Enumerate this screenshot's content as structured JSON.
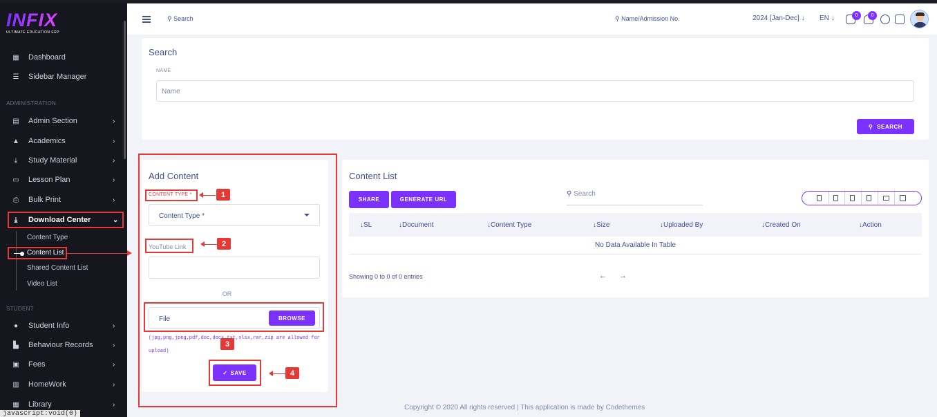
{
  "logo": {
    "name": "INFIX",
    "tagline": "ULTIMATE EDUCATION ERP"
  },
  "sidebar": {
    "top_items": [
      {
        "label": "Dashboard",
        "icon": "grid-icon"
      },
      {
        "label": "Sidebar Manager",
        "icon": "list-icon"
      }
    ],
    "sections": [
      {
        "title": "ADMINISTRATION"
      },
      {
        "title": "STUDENT"
      }
    ],
    "admin_items": [
      {
        "label": "Admin Section",
        "icon": "admin-icon"
      },
      {
        "label": "Academics",
        "icon": "graduation-cap-icon"
      },
      {
        "label": "Study Material",
        "icon": "download-icon"
      },
      {
        "label": "Lesson Plan",
        "icon": "lesson-icon"
      },
      {
        "label": "Bulk Print",
        "icon": "print-icon"
      },
      {
        "label": "Download Center",
        "icon": "download-icon"
      }
    ],
    "download_sub": [
      "Content Type",
      "Content List",
      "Shared Content List",
      "Video List"
    ],
    "student_items": [
      {
        "label": "Student Info",
        "icon": "user-icon"
      },
      {
        "label": "Behaviour Records",
        "icon": "records-icon"
      },
      {
        "label": "Fees",
        "icon": "fees-icon"
      },
      {
        "label": "HomeWork",
        "icon": "book-icon"
      },
      {
        "label": "Library",
        "icon": "library-icon"
      }
    ],
    "status_text": "javascript:void(0)"
  },
  "topbar": {
    "search": "Search",
    "name_search": "Name/Admission No.",
    "year": "2024 [Jan-Dec]",
    "lang": "EN",
    "chat_badge": "0",
    "notif_badge": "0"
  },
  "search_panel": {
    "title": "Search",
    "name_label": "NAME",
    "name_placeholder": "Name",
    "button": "SEARCH"
  },
  "add_content": {
    "title": "Add Content",
    "content_type_label": "CONTENT TYPE *",
    "content_type_value": "Content Type *",
    "youtube_label": "YouTube Link",
    "or": "OR",
    "file_placeholder": "File",
    "browse": "BROWSE",
    "hint": "(jpg,png,jpeg,pdf,doc,docx,txt,xlsx,rar,zip are allowed for upload)",
    "save": "SAVE",
    "step_numbers": [
      "1",
      "2",
      "3",
      "4"
    ]
  },
  "content_list": {
    "title": "Content List",
    "share": "SHARE",
    "generate_url": "GENERATE URL",
    "search_placeholder": "Search",
    "columns": [
      "SL",
      "Document",
      "Content Type",
      "Size",
      "Uploaded By",
      "Created On",
      "Action"
    ],
    "empty": "No Data Available In Table",
    "showing": "Showing 0 to 0 of 0 entries",
    "prev": "←",
    "next": "→"
  },
  "footer": "Copyright © 2020 All rights reserved | This application is made by Codethemes"
}
